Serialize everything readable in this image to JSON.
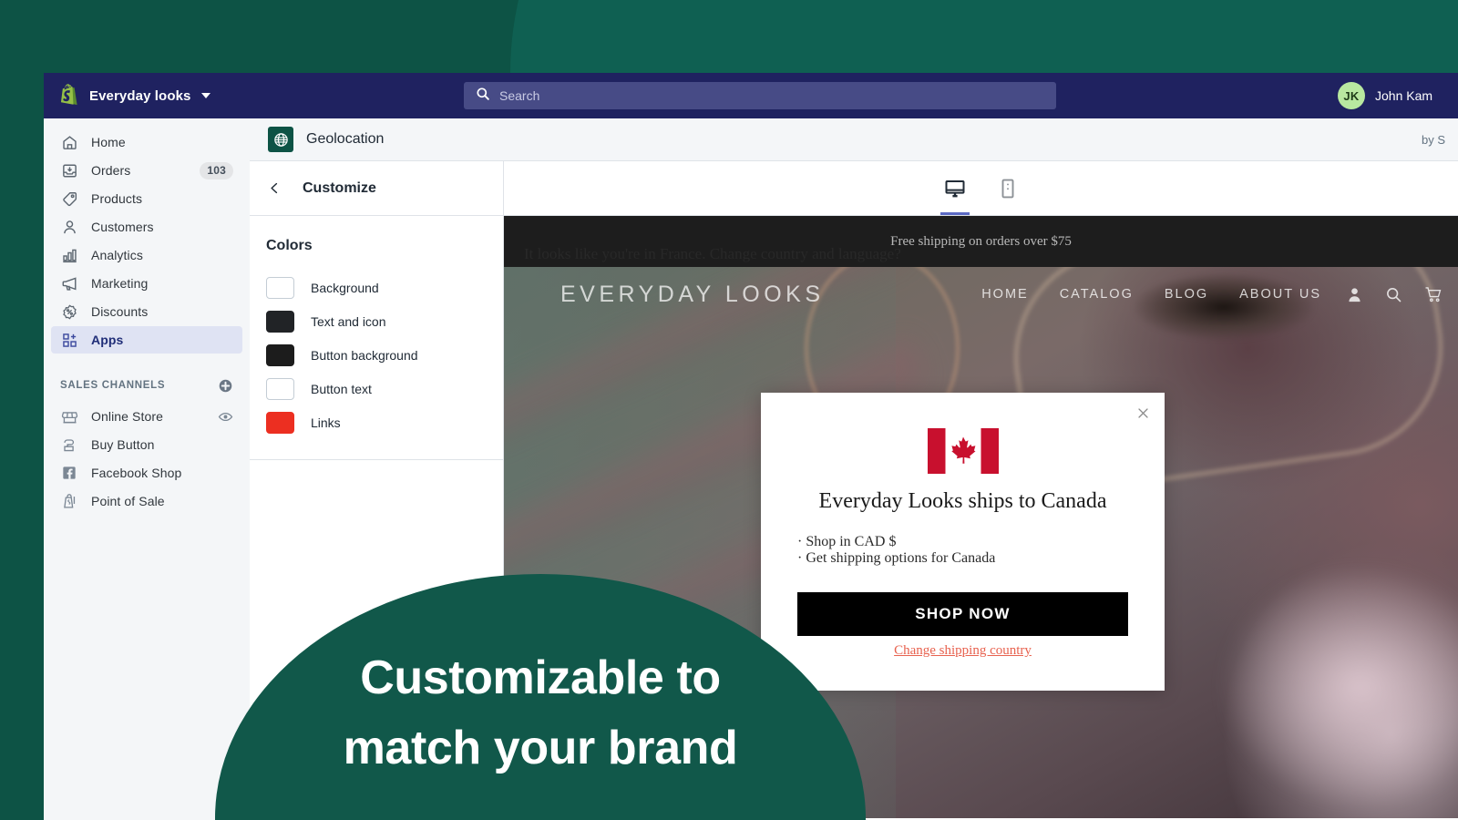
{
  "topbar": {
    "store_name": "Everyday looks",
    "store_switcher_icon": "shopify-logo-icon",
    "caret_icon": "chevron-down-icon",
    "search_icon": "search-icon",
    "search_placeholder": "Search",
    "search_value": "",
    "avatar_initials": "JK",
    "user_name": "John Kam",
    "bg_color": "#1f2260",
    "search_bg_color": "#474b86",
    "avatar_color": "#b8e8a0"
  },
  "sidebar": {
    "items": [
      {
        "label": "Home",
        "icon": "home-icon",
        "badge": "",
        "active": false
      },
      {
        "label": "Orders",
        "icon": "orders-inbox-icon",
        "badge": "103",
        "active": false
      },
      {
        "label": "Products",
        "icon": "tag-icon",
        "badge": "",
        "active": false
      },
      {
        "label": "Customers",
        "icon": "person-icon",
        "badge": "",
        "active": false
      },
      {
        "label": "Analytics",
        "icon": "bar-chart-icon",
        "badge": "",
        "active": false
      },
      {
        "label": "Marketing",
        "icon": "megaphone-icon",
        "badge": "",
        "active": false
      },
      {
        "label": "Discounts",
        "icon": "discount-percent-icon",
        "badge": "",
        "active": false
      },
      {
        "label": "Apps",
        "icon": "apps-grid-plus-icon",
        "badge": "",
        "active": true
      }
    ],
    "sales_channels": {
      "heading": "SALES CHANNELS",
      "add_icon": "plus-circle-icon",
      "items": [
        {
          "label": "Online Store",
          "icon": "storefront-icon",
          "action_icon": "eye-icon"
        },
        {
          "label": "Buy Button",
          "icon": "buy-button-icon",
          "action_icon": ""
        },
        {
          "label": "Facebook Shop",
          "icon": "facebook-icon",
          "action_icon": ""
        },
        {
          "label": "Point of Sale",
          "icon": "point-of-sale-icon",
          "action_icon": ""
        }
      ]
    },
    "active_highlight_color": "#dfe3f3"
  },
  "app_frame": {
    "app_icon": "globe-geolocation-icon",
    "app_title": "Geolocation",
    "byline": "by S"
  },
  "customize": {
    "back_icon": "chevron-left-icon",
    "title": "Customize",
    "colors_section": {
      "title": "Colors",
      "rows": [
        {
          "label": "Background",
          "color": "#ffffff"
        },
        {
          "label": "Text and icon",
          "color": "#212326"
        },
        {
          "label": "Button background",
          "color": "#1c1c1c"
        },
        {
          "label": "Button text",
          "color": "#ffffff"
        },
        {
          "label": "Links",
          "color": "#ec2f21"
        }
      ]
    }
  },
  "preview": {
    "devices": [
      {
        "name": "desktop",
        "icon": "desktop-monitor-icon",
        "active": true
      },
      {
        "name": "mobile",
        "icon": "mobile-phone-icon",
        "active": false
      }
    ],
    "active_underline_color": "#5c6ac4",
    "storefront": {
      "announcement": "Free shipping on orders over $75",
      "geo_banner": "It looks like you're in France. Change country and language?",
      "logo": "EVERYDAY LOOKS",
      "nav_links": [
        "HOME",
        "CATALOG",
        "BLOG",
        "ABOUT US"
      ],
      "nav_icons": [
        "account-person-icon",
        "search-icon",
        "shopping-cart-icon"
      ]
    },
    "geo_modal": {
      "close_icon": "close-x-icon",
      "flag_icon": "canada-flag-icon",
      "heading": "Everyday Looks ships to Canada",
      "bullets": [
        "· Shop in CAD $",
        "· Get shipping options for Canada"
      ],
      "primary_button": "SHOP NOW",
      "secondary_link": "Change shipping country",
      "button_bg_color": "#000000",
      "link_color": "#e8624f"
    }
  },
  "marketing": {
    "headline_line1": "Customizable to",
    "headline_line2": "match your brand",
    "blob_color": "#11584a",
    "backdrop_color": "#0d5345"
  }
}
